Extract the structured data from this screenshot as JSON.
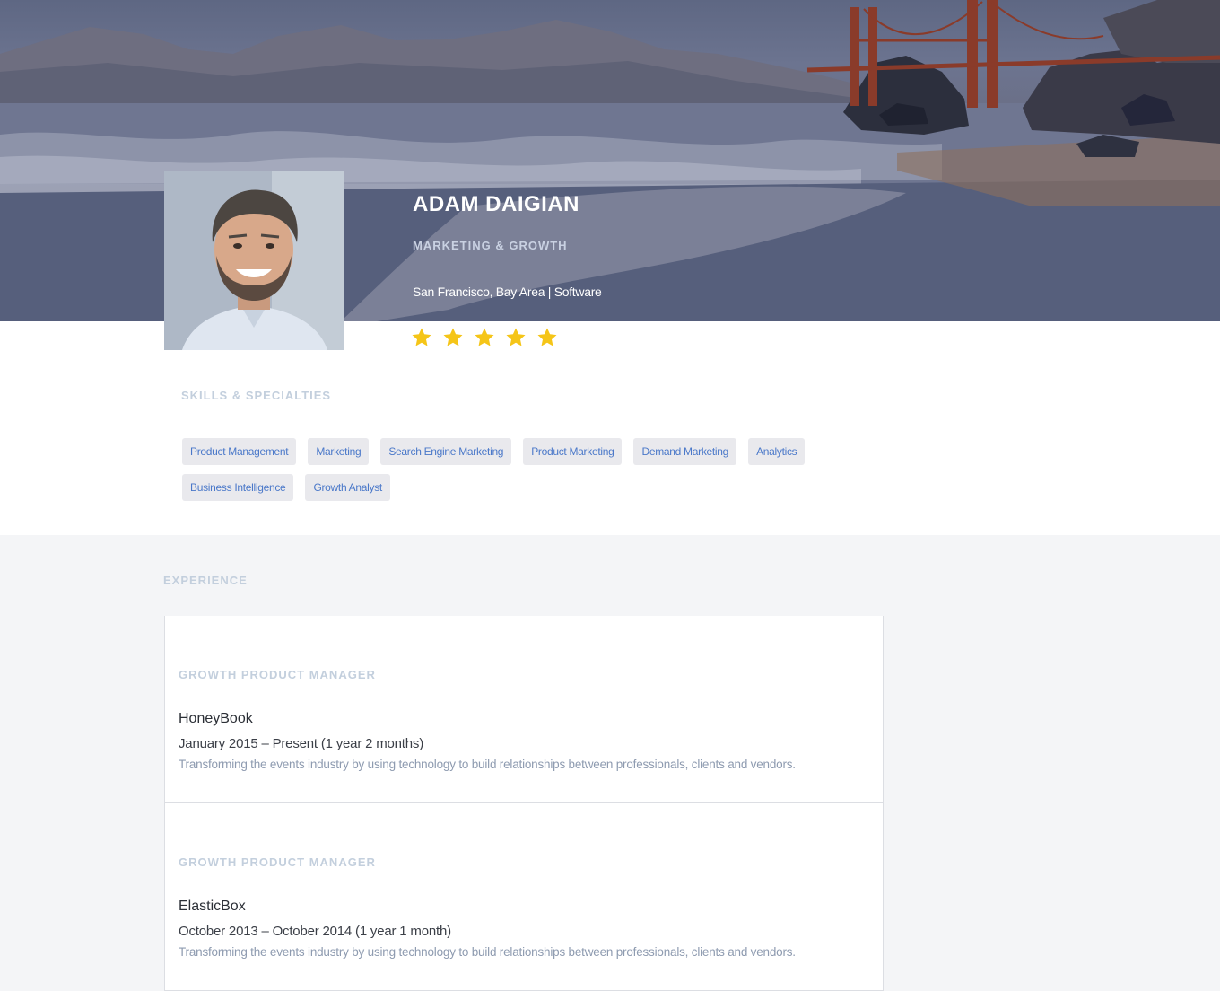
{
  "profile": {
    "name": "ADAM DAIGIAN",
    "role": "MARKETING & GROWTH",
    "location": "San Francisco, Bay Area | Software",
    "rating": 5,
    "rating_max": 5,
    "star_color": "#f5c518"
  },
  "skills": {
    "title": "SKILLS & SPECIALTIES",
    "items": [
      "Product Management",
      "Marketing",
      "Search Engine Marketing",
      "Product Marketing",
      "Demand Marketing",
      "Analytics",
      "Business Intelligence",
      "Growth Analyst"
    ]
  },
  "experience": {
    "title": "EXPERIENCE",
    "items": [
      {
        "title": "GROWTH PRODUCT MANAGER",
        "company": "HoneyBook",
        "dates": "January 2015 – Present (1 year 2 months)",
        "description": "Transforming the events industry by using technology to build relationships between professionals, clients and vendors."
      },
      {
        "title": "GROWTH PRODUCT MANAGER",
        "company": "ElasticBox",
        "dates": "October 2013 – October 2014 (1 year 1 month)",
        "description": "Transforming the events industry by using technology to build relationships between professionals, clients and vendors."
      }
    ]
  }
}
